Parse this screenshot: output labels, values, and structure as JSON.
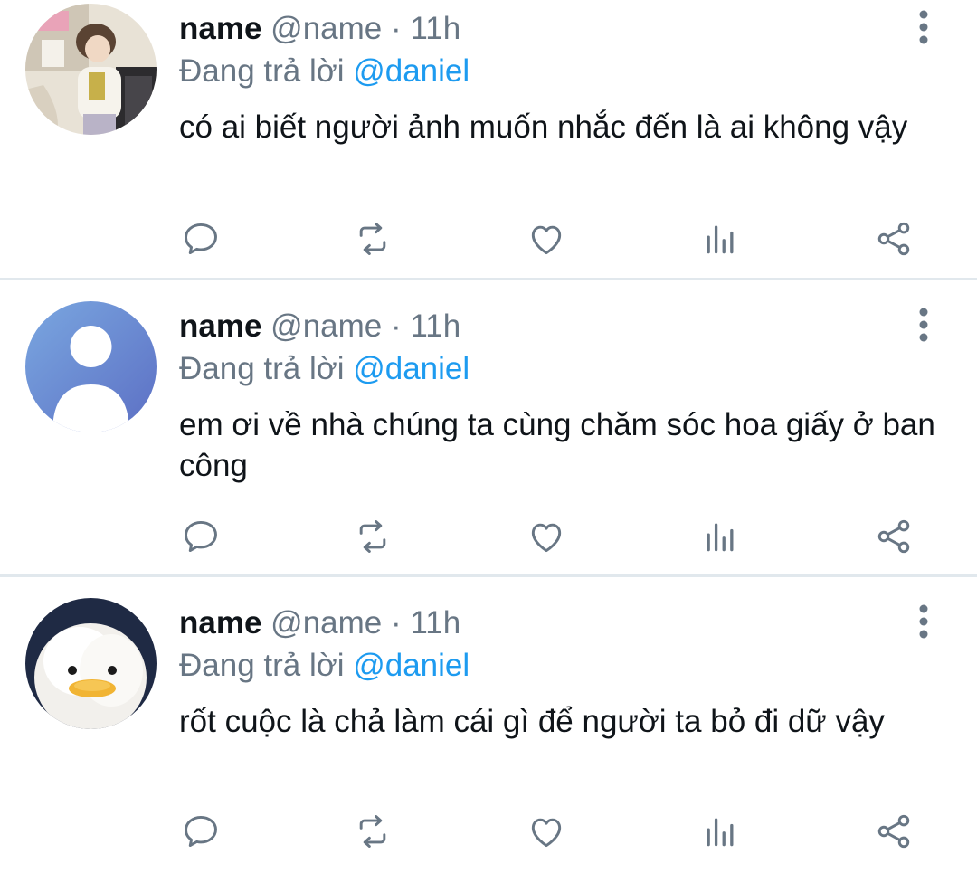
{
  "colors": {
    "text_primary": "#0f1419",
    "text_secondary": "#687684",
    "mention": "#1d9bf0",
    "divider": "#e1e8ed"
  },
  "tweets": [
    {
      "display_name": "name",
      "handle": "@name",
      "separator": "·",
      "time": "11h",
      "replying_to_prefix": "Đang trả lời",
      "replying_to_user": "@daniel",
      "text": "có ai biết người ảnh muốn nhắc đến là ai không vậy",
      "avatar": "photo-person-avatar"
    },
    {
      "display_name": "name",
      "handle": "@name",
      "separator": "·",
      "time": "11h",
      "replying_to_prefix": "Đang trả lời",
      "replying_to_user": "@daniel",
      "text": "em ơi về nhà chúng ta cùng chăm sóc hoa giấy ở ban công",
      "avatar": "default-user-avatar"
    },
    {
      "display_name": "name",
      "handle": "@name",
      "separator": "·",
      "time": "11h",
      "replying_to_prefix": "Đang trả lời",
      "replying_to_user": "@daniel",
      "text": "rốt cuộc là chả làm cái gì để người ta bỏ đi dữ vậy",
      "avatar": "fluffy-duck-avatar"
    }
  ],
  "action_icons": [
    "reply-icon",
    "retweet-icon",
    "like-icon",
    "views-icon",
    "share-icon"
  ],
  "more_icon": "more-vertical-icon"
}
